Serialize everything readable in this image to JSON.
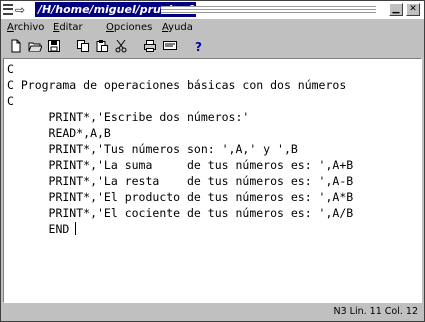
{
  "window": {
    "title": "/H/home/miguel/prueba.f"
  },
  "titlebar": {
    "pin_glyph": "⇨",
    "minimize_glyph": "▁",
    "close_glyph": "✕"
  },
  "menu": [
    {
      "access": "A",
      "rest": "rchivo"
    },
    {
      "access": "E",
      "rest": "ditar"
    },
    {
      "access": "O",
      "rest": "pciones"
    },
    {
      "access": "A",
      "rest": "yuda"
    }
  ],
  "toolbar": [
    {
      "name": "new-file-icon"
    },
    {
      "name": "open-file-icon"
    },
    {
      "name": "save-icon"
    },
    {
      "name": "copy-icon"
    },
    {
      "name": "paste-icon"
    },
    {
      "name": "cut-icon"
    },
    {
      "name": "print-icon"
    },
    {
      "name": "preview-icon"
    },
    {
      "name": "help-icon"
    }
  ],
  "editor": {
    "lines": [
      "C",
      "C Programa de operaciones básicas con dos números",
      "C",
      "      PRINT*,'Escribe dos números:'",
      "      READ*,A,B",
      "      PRINT*,'Tus números son: ',A,' y ',B",
      "      PRINT*,'La suma     de tus números es: ',A+B",
      "      PRINT*,'La resta    de tus números es: ',A-B",
      "      PRINT*,'El producto de tus números es: ',A*B",
      "      PRINT*,'El cociente de tus números es: ',A/B",
      "      END"
    ]
  },
  "status": {
    "text": "N3  Lin. 11 Col. 12"
  },
  "colors": {
    "title_bg": "#000080",
    "chrome": "#c0c0c0",
    "editor_bg": "#ffffff"
  }
}
